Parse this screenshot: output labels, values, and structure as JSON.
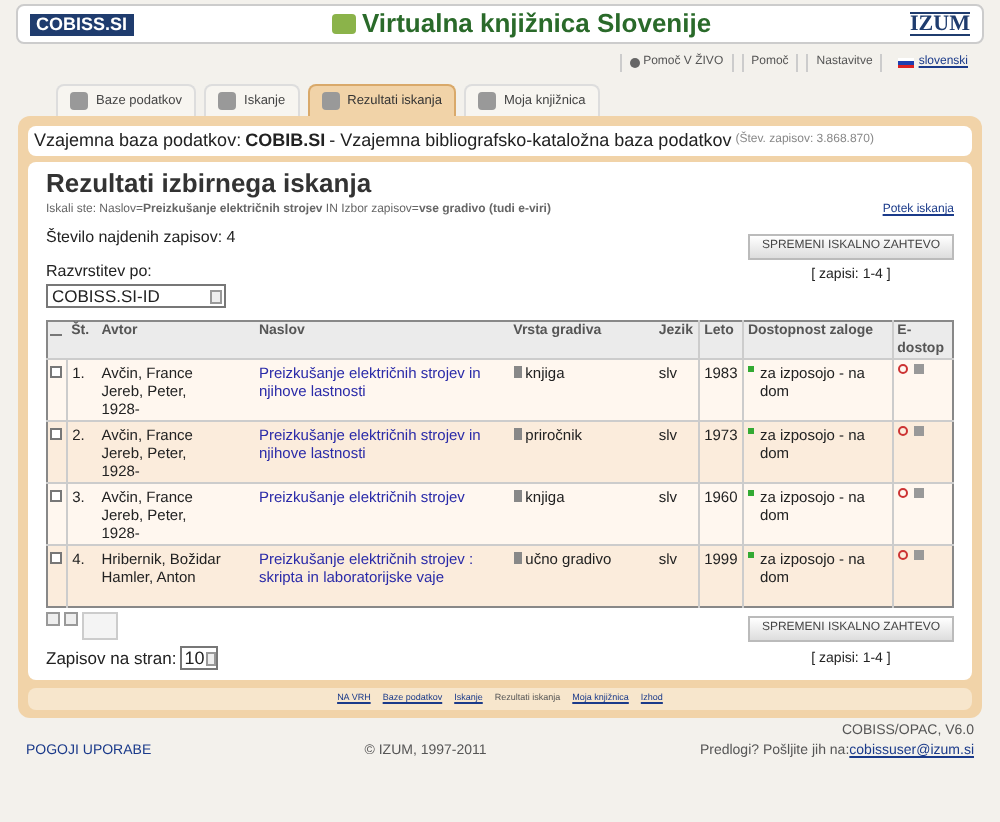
{
  "header": {
    "logo": "COBISS.SI",
    "title": "Virtualna knjižnica Slovenije",
    "izum": "IZUM"
  },
  "top_links": [
    {
      "label": "Pomoč V ŽIVO",
      "kind": "help-live"
    },
    {
      "label": "Pomoč",
      "kind": "plain"
    },
    {
      "label": "Nastavitve",
      "kind": "plain"
    },
    {
      "label": "slovenski",
      "kind": "language"
    }
  ],
  "tabs": [
    {
      "label": "Baze podatkov",
      "selected": false
    },
    {
      "label": "Iskanje",
      "selected": false
    },
    {
      "label": "Rezultati iskanja",
      "selected": true
    },
    {
      "label": "Moja knjižnica",
      "selected": false
    }
  ],
  "database": {
    "prefix": "Vzajemna baza podatkov: ",
    "name": "COBIB.SI",
    "description": " - Vzajemna bibliografsko-kataložna baza podatkov",
    "count": "(Štev. zapisov: 3.868.870)"
  },
  "results": {
    "title": "Rezultati izbirnega iskanja",
    "query": "Iskali ste: Naslov=**Preizkušanje električnih strojev** IN Izbor zapisov=**vse gradivo (tudi e-viri)**",
    "history_link": "Potek iskanja",
    "found": "Število najdenih zapisov: 4",
    "modify_button": "SPREMENI ISKALNO ZAHTEVO",
    "range": "[ zapisi: 1-4 ]",
    "sort_label": "Razvrstitev po:",
    "sort_value": "COBISS.SI-ID"
  },
  "table": {
    "columns": [
      "Št.",
      "Avtor",
      "Naslov",
      "Vrsta gradiva",
      "Jezik",
      "Leto",
      "Dostopnost zaloge",
      "E-dostop"
    ],
    "rows": [
      {
        "checked": false,
        "number": "1.",
        "author": "Avčin, France Jereb, Peter, 1928-",
        "title": "Preizkušanje električnih strojev in njihove lastnosti",
        "type": "knjiga",
        "language": "slv",
        "year": "1983",
        "availability": "za izposojo - na dom"
      },
      {
        "checked": false,
        "number": "2.",
        "author": "Avčin, France Jereb, Peter, 1928-",
        "title": "Preizkušanje električnih strojev in njihove lastnosti",
        "type": "priročnik",
        "language": "slv",
        "year": "1973",
        "availability": "za izposojo - na dom"
      },
      {
        "checked": false,
        "number": "3.",
        "author": "Avčin, France Jereb, Peter, 1928-",
        "title": "Preizkušanje električnih strojev",
        "type": "knjiga",
        "language": "slv",
        "year": "1960",
        "availability": "za izposojo - na dom"
      },
      {
        "checked": false,
        "number": "4.",
        "author": "Hribernik, Božidar Hamler, Anton",
        "title": "Preizkušanje električnih strojev : skripta in laboratorijske vaje",
        "type": "učno gradivo",
        "language": "slv",
        "year": "1999",
        "availability": "za izposojo - na dom"
      }
    ]
  },
  "bottom": {
    "modify_button": "SPREMENI ISKALNO ZAHTEVO",
    "range": "[ zapisi: 1-4 ]",
    "per_page_label": "Zapisov na stran:",
    "per_page_value": "10"
  },
  "footer_nav": [
    {
      "label": "NA VRH",
      "selected": false
    },
    {
      "label": "Baze podatkov",
      "selected": false
    },
    {
      "label": "Iskanje",
      "selected": false
    },
    {
      "label": "Rezultati iskanja",
      "selected": true
    },
    {
      "label": "Moja knjižnica",
      "selected": false
    },
    {
      "label": "Izhod",
      "selected": false
    }
  ],
  "footer": {
    "terms": "POGOJI UPORABE",
    "copyright": "© IZUM, 1997-2011",
    "version": "COBISS/OPAC, V6.0",
    "suggest": "Predlogi? Pošljite jih na: ",
    "email": "cobissuser@izum.si"
  }
}
